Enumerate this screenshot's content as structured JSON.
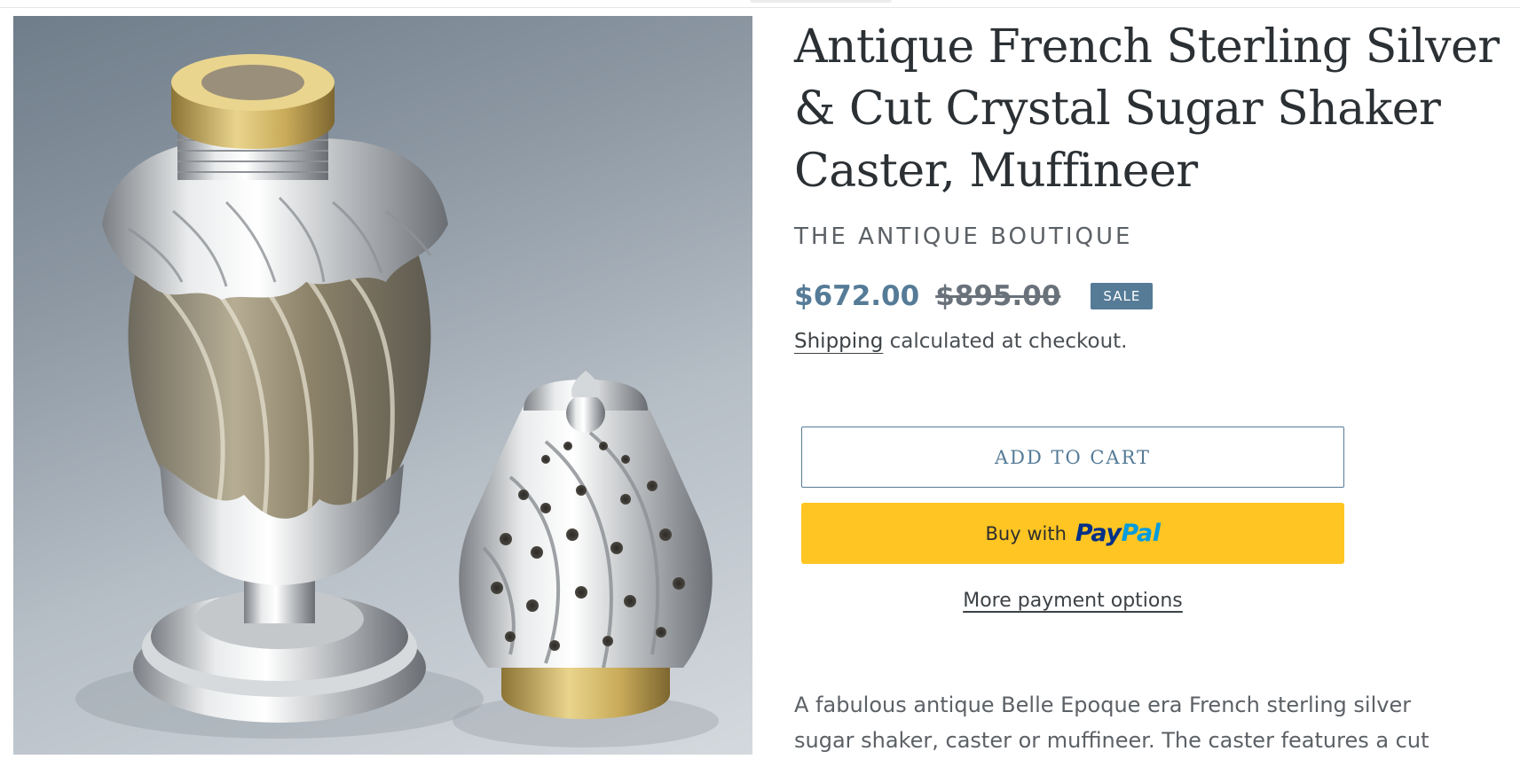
{
  "product": {
    "title": "Antique French Sterling Silver & Cut Crystal Sugar Shaker Caster, Muffineer",
    "vendor": "THE ANTIQUE BOUTIQUE",
    "price": {
      "sale": "$672.00",
      "regular": "$895.00",
      "badge": "SALE"
    },
    "shipping": {
      "link_label": "Shipping",
      "text": " calculated at checkout."
    },
    "buttons": {
      "add_to_cart": "ADD TO CART",
      "paypal_prefix": "Buy with",
      "paypal_logo_pay": "Pay",
      "paypal_logo_pal": "Pal",
      "more_payment_options": "More payment options"
    },
    "description_lines": [
      "A fabulous antique Belle Epoque era French sterling silver",
      "sugar shaker, caster or muffineer. The caster features a cut"
    ]
  },
  "colors": {
    "accent": "#557b97",
    "paypal_yellow": "#ffc522",
    "paypal_blue_dark": "#003087",
    "paypal_blue_light": "#009cde",
    "heading": "#2b3034"
  },
  "image": {
    "alt": "Antique French Sterling Silver & Cut Crystal Sugar Shaker Caster, Muffineer"
  }
}
